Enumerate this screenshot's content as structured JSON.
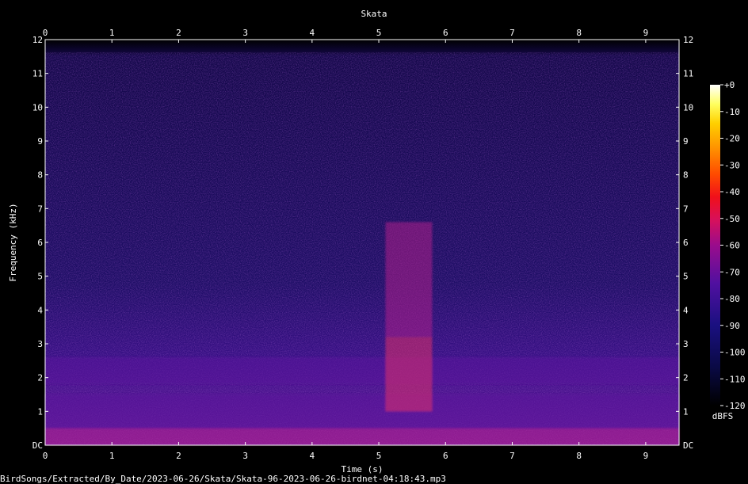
{
  "chart_data": {
    "type": "heatmap",
    "title": "Skata",
    "xlabel": "Time (s)",
    "ylabel": "Frequency (kHz)",
    "xlim": [
      0,
      9.5
    ],
    "ylim": [
      0,
      12
    ],
    "x_ticks": [
      "0",
      "1",
      "2",
      "3",
      "4",
      "5",
      "6",
      "7",
      "8",
      "9"
    ],
    "y_ticks": [
      "DC",
      "1",
      "2",
      "3",
      "4",
      "5",
      "6",
      "7",
      "8",
      "9",
      "10",
      "11",
      "12"
    ],
    "colorbar": {
      "label": "dBFS",
      "ticks": [
        "+0",
        "-10",
        "-20",
        "-30",
        "-40",
        "-50",
        "-60",
        "-70",
        "-80",
        "-90",
        "-100",
        "-110",
        "-120"
      ],
      "range": [
        -120,
        0
      ]
    },
    "signal_bands": [
      {
        "t_start": 0.0,
        "t_end": 9.5,
        "f_low": 0.0,
        "f_high": 0.5,
        "level_dbfs": -72
      },
      {
        "t_start": 0.0,
        "t_end": 9.5,
        "f_low": 0.5,
        "f_high": 1.5,
        "level_dbfs": -85
      },
      {
        "t_start": 0.0,
        "t_end": 9.5,
        "f_low": 1.8,
        "f_high": 2.6,
        "level_dbfs": -88
      },
      {
        "t_start": 5.1,
        "t_end": 5.8,
        "f_low": 1.0,
        "f_high": 3.2,
        "level_dbfs": -65
      },
      {
        "t_start": 5.1,
        "t_end": 5.8,
        "f_low": 3.2,
        "f_high": 6.6,
        "level_dbfs": -78
      }
    ],
    "grid": false
  },
  "colors": {
    "background": "#000000",
    "noise_floor": "#1a0d55",
    "signal_low": "#5a1a9a",
    "signal_mid": "#b0208a",
    "signal_high": "#e0306a"
  },
  "footer": {
    "path": "BirdSongs/Extracted/By_Date/2023-06-26/Skata/Skata-96-2023-06-26-birdnet-04:18:43.mp3"
  }
}
